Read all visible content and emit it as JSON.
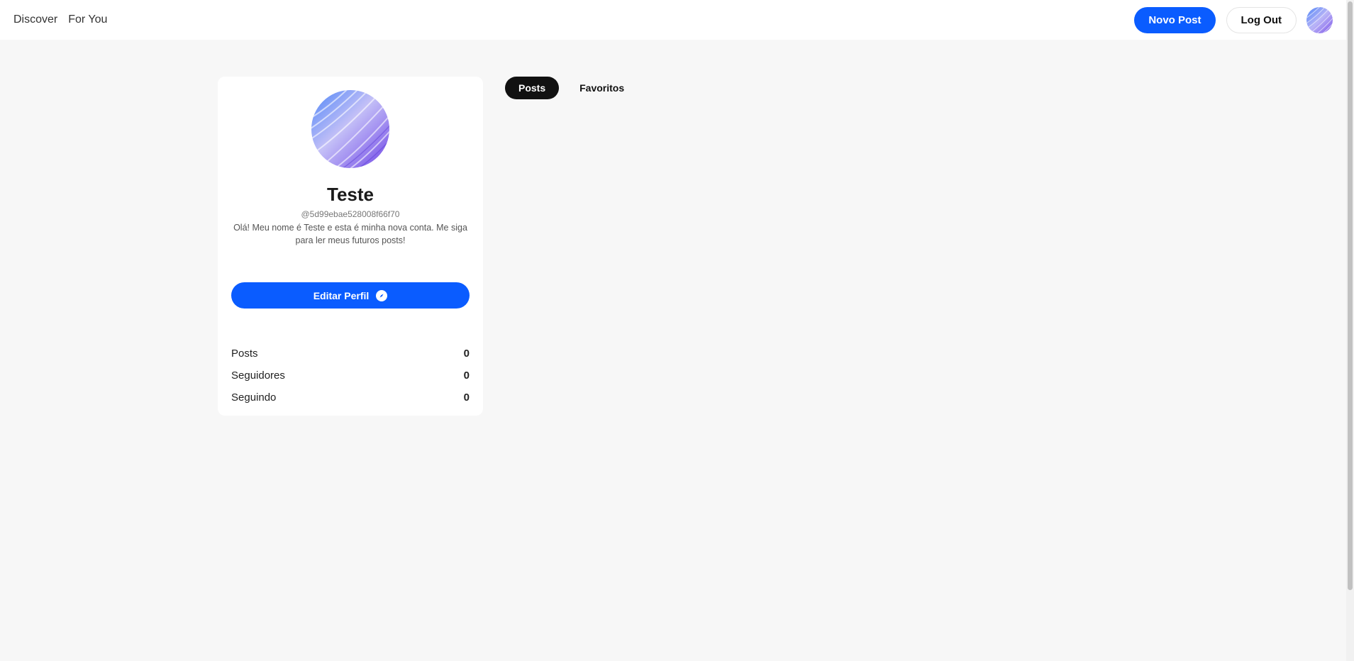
{
  "nav": {
    "links": [
      "Discover",
      "For You"
    ],
    "new_post_label": "Novo Post",
    "logout_label": "Log Out"
  },
  "profile": {
    "name": "Teste",
    "handle": "@5d99ebae528008f66f70",
    "bio": "Olá! Meu nome é Teste e esta é minha nova conta. Me siga para ler meus futuros posts!",
    "edit_label": "Editar Perfil",
    "stats": [
      {
        "label": "Posts",
        "value": "0"
      },
      {
        "label": "Seguidores",
        "value": "0"
      },
      {
        "label": "Seguindo",
        "value": "0"
      }
    ]
  },
  "tabs": [
    {
      "label": "Posts",
      "active": true
    },
    {
      "label": "Favoritos",
      "active": false
    }
  ],
  "colors": {
    "accent": "#0a5cff",
    "active_tab": "#111111",
    "background": "#f7f7f7"
  }
}
